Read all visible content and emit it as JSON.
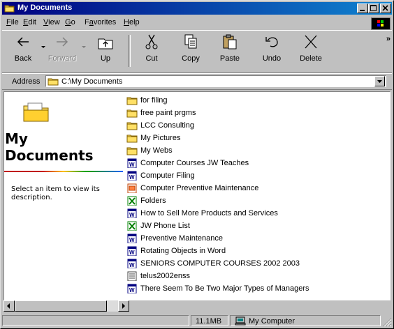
{
  "window": {
    "title": "My Documents",
    "menu": [
      "File",
      "Edit",
      "View",
      "Go",
      "Favorites",
      "Help"
    ],
    "menu_underline": [
      "F",
      "E",
      "V",
      "G",
      "a",
      "H"
    ]
  },
  "toolbar": {
    "back": "Back",
    "forward": "Forward",
    "up": "Up",
    "cut": "Cut",
    "copy": "Copy",
    "paste": "Paste",
    "undo": "Undo",
    "delete": "Delete",
    "more": "»"
  },
  "address": {
    "label": "Address",
    "value": "C:\\My Documents"
  },
  "webview": {
    "title_line1": "My",
    "title_line2": "Documents",
    "description": "Select an item to view its description."
  },
  "files": [
    {
      "name": "for filing",
      "icon": "folder-icon"
    },
    {
      "name": "free paint prgms",
      "icon": "folder-icon"
    },
    {
      "name": "LCC Consulting",
      "icon": "folder-icon"
    },
    {
      "name": "My Pictures",
      "icon": "folder-icon"
    },
    {
      "name": "My Webs",
      "icon": "folder-icon"
    },
    {
      "name": "Computer Courses JW Teaches",
      "icon": "word-doc-icon"
    },
    {
      "name": "Computer Filing",
      "icon": "word-doc-icon"
    },
    {
      "name": "Computer Preventive Maintenance",
      "icon": "powerpoint-icon"
    },
    {
      "name": "Folders",
      "icon": "excel-icon"
    },
    {
      "name": "How to Sell More Products and Services",
      "icon": "word-doc-icon"
    },
    {
      "name": "JW Phone List",
      "icon": "excel-icon"
    },
    {
      "name": "Preventive Maintenance",
      "icon": "word-doc-icon"
    },
    {
      "name": "Rotating Objects in Word",
      "icon": "word-doc-icon"
    },
    {
      "name": "SENIORS COMPUTER COURSES 2002 2003",
      "icon": "word-doc-icon"
    },
    {
      "name": "telus2002enss",
      "icon": "generic-file-icon"
    },
    {
      "name": "There Seem To Be Two Major Types of Managers",
      "icon": "word-doc-icon"
    }
  ],
  "status": {
    "size": "11.1MB",
    "zone": "My Computer"
  },
  "colors": {
    "titlebar": "#000080",
    "face": "#c0c0c0",
    "folder": "#ffe066"
  }
}
